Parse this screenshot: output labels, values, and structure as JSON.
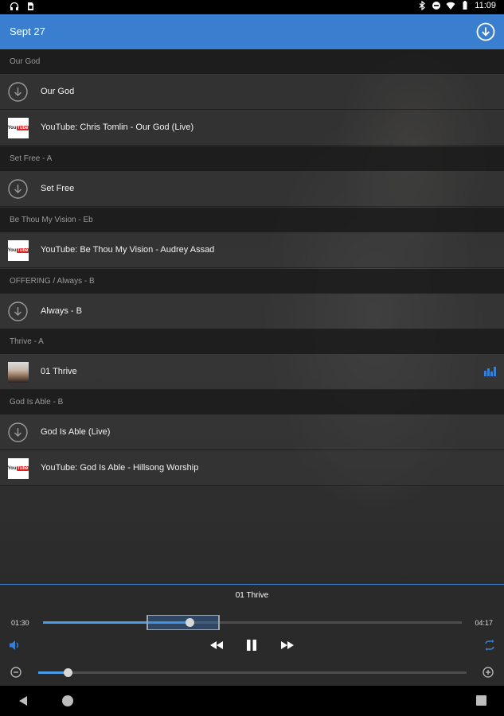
{
  "status_bar": {
    "time": "11:09",
    "left_icons": [
      "headphones-icon",
      "sim-card-icon"
    ],
    "right_icons": [
      "bluetooth-icon",
      "do-not-disturb-icon",
      "wifi-icon",
      "battery-icon"
    ]
  },
  "app_bar": {
    "title": "Sept 27",
    "action_icon": "download-circle-icon",
    "color": "#3a7fcf"
  },
  "sections": [
    {
      "header": "Our God",
      "items": [
        {
          "type": "download",
          "icon": "download-circle-icon",
          "label": "Our God"
        },
        {
          "type": "youtube",
          "icon": "youtube-icon",
          "label": "YouTube: Chris Tomlin - Our God (Live)"
        }
      ]
    },
    {
      "header": "Set Free - A",
      "items": [
        {
          "type": "download",
          "icon": "download-circle-icon",
          "label": "Set Free"
        }
      ]
    },
    {
      "header": "Be Thou My Vision - Eb",
      "items": [
        {
          "type": "youtube",
          "icon": "youtube-icon",
          "label": "YouTube: Be Thou My Vision - Audrey Assad"
        }
      ]
    },
    {
      "header": "OFFERING / Always - B",
      "items": [
        {
          "type": "download",
          "icon": "download-circle-icon",
          "label": "Always - B"
        }
      ]
    },
    {
      "header": "Thrive - A",
      "items": [
        {
          "type": "track",
          "icon": "album-art-thumbnail",
          "label": "01 Thrive",
          "playing": true
        }
      ]
    },
    {
      "header": "God Is Able - B",
      "items": [
        {
          "type": "download",
          "icon": "download-circle-icon",
          "label": "God Is Able (Live)"
        },
        {
          "type": "youtube",
          "icon": "youtube-icon",
          "label": "YouTube: God Is Able - Hillsong Worship"
        }
      ]
    }
  ],
  "youtube_logo_text": {
    "you": "You",
    "tube": "Tube"
  },
  "player": {
    "now_playing": "01 Thrive",
    "elapsed": "01:30",
    "duration": "04:17",
    "progress_fraction": 0.35,
    "loop_region": {
      "start_fraction": 0.247,
      "end_fraction": 0.422
    },
    "speed_fraction": 0.07,
    "accent": "#4a9ce8",
    "controls": [
      "volume-icon",
      "rewind-icon",
      "pause-icon",
      "fast-forward-icon",
      "repeat-icon"
    ],
    "speed_controls": [
      "zoom-out-icon",
      "zoom-in-icon"
    ]
  },
  "nav_bar": {
    "buttons": [
      "back-icon",
      "home-icon",
      "recents-icon"
    ]
  }
}
